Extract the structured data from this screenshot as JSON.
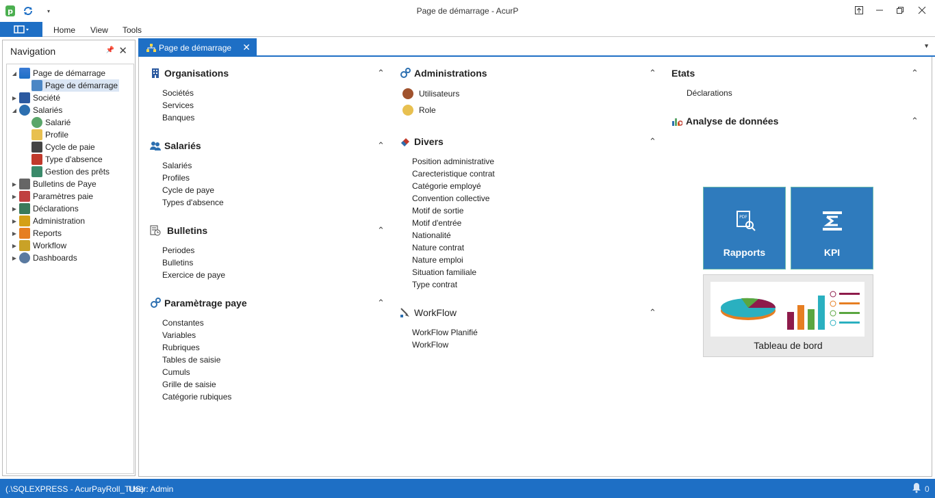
{
  "window": {
    "title": "Page de démarrage - AcurP"
  },
  "ribbon": {
    "tabs": [
      "Home",
      "View",
      "Tools"
    ]
  },
  "navigation": {
    "title": "Navigation",
    "tree": [
      {
        "label": "Page de démarrage",
        "level": 0,
        "expanded": true,
        "icon": "sitemap-icon"
      },
      {
        "label": "Page de démarrage",
        "level": 1,
        "selected": true,
        "icon": "sitemap-icon"
      },
      {
        "label": "Société",
        "level": 0,
        "expanded": false,
        "icon": "building-icon"
      },
      {
        "label": "Salariés",
        "level": 0,
        "expanded": true,
        "icon": "users-icon"
      },
      {
        "label": "Salarié",
        "level": 1,
        "icon": "user-icon"
      },
      {
        "label": "Profile",
        "level": 1,
        "icon": "profile-mask-icon"
      },
      {
        "label": "Cycle de paie",
        "level": 1,
        "icon": "cycle-icon"
      },
      {
        "label": "Type d'absence",
        "level": 1,
        "icon": "calendar-icon"
      },
      {
        "label": "Gestion des prêts",
        "level": 1,
        "icon": "loan-icon"
      },
      {
        "label": "Bulletins de Paye",
        "level": 0,
        "expanded": false,
        "icon": "payslip-icon"
      },
      {
        "label": "Paramètres paie",
        "level": 0,
        "expanded": false,
        "icon": "settings-chart-icon"
      },
      {
        "label": "Déclarations",
        "level": 0,
        "expanded": false,
        "icon": "declaration-icon"
      },
      {
        "label": "Administration",
        "level": 0,
        "expanded": false,
        "icon": "lock-icon"
      },
      {
        "label": "Reports",
        "level": 0,
        "expanded": false,
        "icon": "report-icon"
      },
      {
        "label": "Workflow",
        "level": 0,
        "expanded": false,
        "icon": "workflow-icon"
      },
      {
        "label": "Dashboards",
        "level": 0,
        "expanded": false,
        "icon": "dashboard-icon"
      }
    ]
  },
  "doc_tab": {
    "label": "Page de démarrage"
  },
  "columns": {
    "col1": [
      {
        "title": "Organisations",
        "icon": "building-icon",
        "items": [
          "Sociétés",
          "Services",
          "Banques"
        ]
      },
      {
        "title": "Salariés",
        "icon": "users-icon",
        "items": [
          "Salariés",
          "Profiles",
          "Cycle de paye",
          "Types d'absence"
        ]
      },
      {
        "title": "Bulletins",
        "icon": "payslip-icon",
        "items": [
          "Periodes",
          "Bulletins",
          "Exercice de paye"
        ]
      },
      {
        "title": "Paramètrage paye",
        "icon": "gears-icon",
        "items": [
          "Constantes",
          "Variables",
          "Rubriques",
          "Tables de saisie",
          "Cumuls",
          "Grille de saisie",
          "Catégorie rubiques"
        ]
      }
    ],
    "col2": [
      {
        "title": "Administrations",
        "icon": "gears-icon",
        "items": [
          "Utilisateurs",
          "Role"
        ]
      },
      {
        "title": "Divers",
        "icon": "eraser-icon",
        "items": [
          "Position administrative",
          "Carecteristique contrat",
          "Catégorie employé",
          "Convention collective",
          "Motif de sortie",
          "Motif d'entrée",
          "Nationalité",
          "Nature contrat",
          "Nature emploi",
          "Situation familiale",
          "Type contrat"
        ]
      },
      {
        "title": "WorkFlow",
        "icon": "workflow-icon",
        "items": [
          "WorkFlow Planifié",
          "WorkFlow"
        ]
      }
    ],
    "col3": [
      {
        "title": "Etats",
        "items": [
          "Déclarations"
        ]
      },
      {
        "title": "Analyse de données",
        "icon": "analytics-icon",
        "items": []
      }
    ]
  },
  "tiles": {
    "rapports": "Rapports",
    "kpi": "KPI",
    "dashboard": "Tableau de bord"
  },
  "status": {
    "connection": "(.\\SQLEXPRESS - AcurPayRoll_TUS)",
    "user": "User: Admin"
  }
}
